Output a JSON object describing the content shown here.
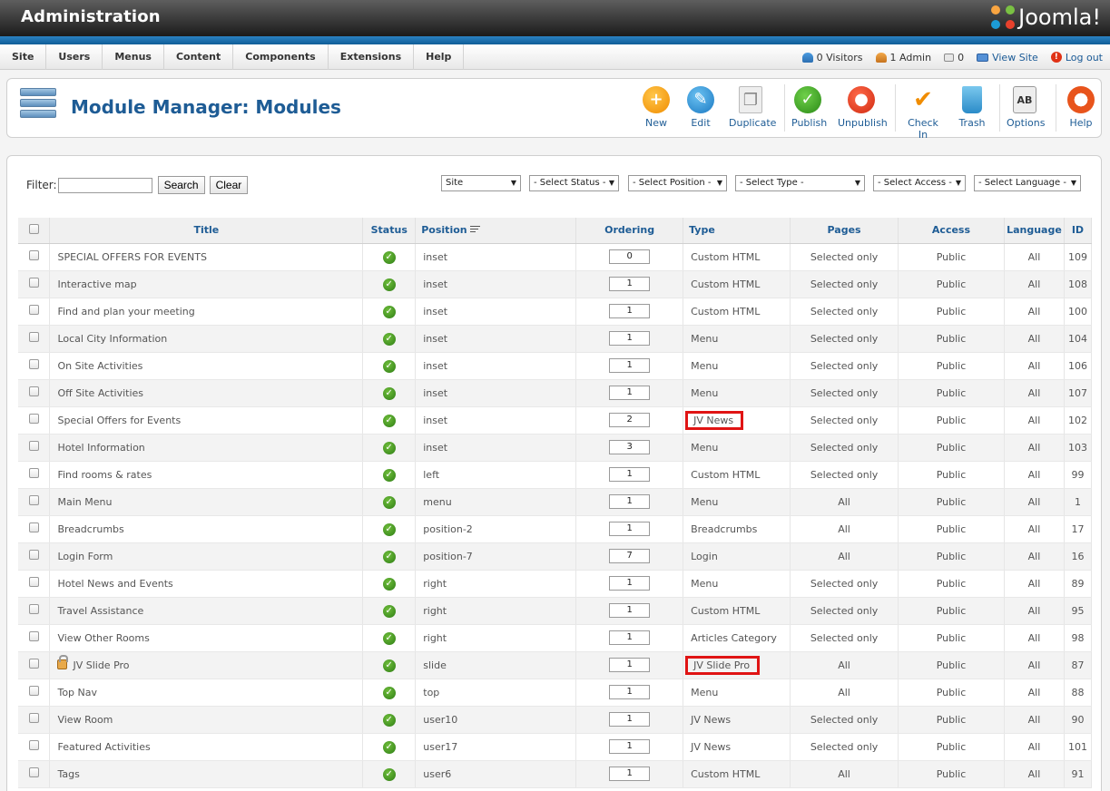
{
  "header": {
    "title": "Administration",
    "logo_text": "Joomla!"
  },
  "menu": [
    "Site",
    "Users",
    "Menus",
    "Content",
    "Components",
    "Extensions",
    "Help"
  ],
  "status": {
    "visitors": "0 Visitors",
    "admins": "1 Admin",
    "messages": "0",
    "view_site": "View Site",
    "logout": "Log out"
  },
  "toolbar": {
    "page_title": "Module Manager: Modules",
    "buttons": [
      "New",
      "Edit",
      "Duplicate",
      "Publish",
      "Unpublish",
      "Check In",
      "Trash",
      "Options",
      "Help"
    ]
  },
  "filter": {
    "label": "Filter:",
    "value": "",
    "search_label": "Search",
    "clear_label": "Clear",
    "selects": [
      "Site",
      "- Select Status -",
      "- Select Position -",
      "- Select Type -",
      "- Select Access -",
      "- Select Language -"
    ]
  },
  "table": {
    "headers": {
      "title": "Title",
      "status": "Status",
      "position": "Position",
      "ordering": "Ordering",
      "type": "Type",
      "pages": "Pages",
      "access": "Access",
      "language": "Language",
      "id": "ID"
    },
    "rows": [
      {
        "title": "SPECIAL OFFERS FOR EVENTS",
        "position": "inset",
        "ordering": "0",
        "type": "Custom HTML",
        "pages": "Selected only",
        "access": "Public",
        "language": "All",
        "id": "109"
      },
      {
        "title": "Interactive map",
        "position": "inset",
        "ordering": "1",
        "type": "Custom HTML",
        "pages": "Selected only",
        "access": "Public",
        "language": "All",
        "id": "108"
      },
      {
        "title": "Find and plan your meeting",
        "position": "inset",
        "ordering": "1",
        "type": "Custom HTML",
        "pages": "Selected only",
        "access": "Public",
        "language": "All",
        "id": "100"
      },
      {
        "title": "Local City Information",
        "position": "inset",
        "ordering": "1",
        "type": "Menu",
        "pages": "Selected only",
        "access": "Public",
        "language": "All",
        "id": "104"
      },
      {
        "title": "On Site Activities",
        "position": "inset",
        "ordering": "1",
        "type": "Menu",
        "pages": "Selected only",
        "access": "Public",
        "language": "All",
        "id": "106"
      },
      {
        "title": "Off Site Activities",
        "position": "inset",
        "ordering": "1",
        "type": "Menu",
        "pages": "Selected only",
        "access": "Public",
        "language": "All",
        "id": "107"
      },
      {
        "title": "Special Offers for Events",
        "position": "inset",
        "ordering": "2",
        "type": "JV News",
        "pages": "Selected only",
        "access": "Public",
        "language": "All",
        "id": "102"
      },
      {
        "title": "Hotel Information",
        "position": "inset",
        "ordering": "3",
        "type": "Menu",
        "pages": "Selected only",
        "access": "Public",
        "language": "All",
        "id": "103"
      },
      {
        "title": "Find rooms & rates",
        "position": "left",
        "ordering": "1",
        "type": "Custom HTML",
        "pages": "Selected only",
        "access": "Public",
        "language": "All",
        "id": "99"
      },
      {
        "title": "Main Menu",
        "position": "menu",
        "ordering": "1",
        "type": "Menu",
        "pages": "All",
        "access": "Public",
        "language": "All",
        "id": "1"
      },
      {
        "title": "Breadcrumbs",
        "position": "position-2",
        "ordering": "1",
        "type": "Breadcrumbs",
        "pages": "All",
        "access": "Public",
        "language": "All",
        "id": "17"
      },
      {
        "title": "Login Form",
        "position": "position-7",
        "ordering": "7",
        "type": "Login",
        "pages": "All",
        "access": "Public",
        "language": "All",
        "id": "16"
      },
      {
        "title": "Hotel News and Events",
        "position": "right",
        "ordering": "1",
        "type": "Menu",
        "pages": "Selected only",
        "access": "Public",
        "language": "All",
        "id": "89"
      },
      {
        "title": "Travel Assistance",
        "position": "right",
        "ordering": "1",
        "type": "Custom HTML",
        "pages": "Selected only",
        "access": "Public",
        "language": "All",
        "id": "95"
      },
      {
        "title": "View Other Rooms",
        "position": "right",
        "ordering": "1",
        "type": "Articles Category",
        "pages": "Selected only",
        "access": "Public",
        "language": "All",
        "id": "98"
      },
      {
        "title": "JV Slide Pro",
        "position": "slide",
        "ordering": "1",
        "type": "JV Slide Pro",
        "pages": "All",
        "access": "Public",
        "language": "All",
        "id": "87"
      },
      {
        "title": "Top Nav",
        "position": "top",
        "ordering": "1",
        "type": "Menu",
        "pages": "All",
        "access": "Public",
        "language": "All",
        "id": "88"
      },
      {
        "title": "View Room",
        "position": "user10",
        "ordering": "1",
        "type": "JV News",
        "pages": "Selected only",
        "access": "Public",
        "language": "All",
        "id": "90"
      },
      {
        "title": "Featured Activities",
        "position": "user17",
        "ordering": "1",
        "type": "JV News",
        "pages": "Selected only",
        "access": "Public",
        "language": "All",
        "id": "101"
      },
      {
        "title": "Tags",
        "position": "user6",
        "ordering": "1",
        "type": "Custom HTML",
        "pages": "All",
        "access": "Public",
        "language": "All",
        "id": "91"
      }
    ]
  },
  "colors": {
    "accent": "#1e5c95",
    "highlight": "#e01414",
    "published": "#3a8c1c"
  }
}
